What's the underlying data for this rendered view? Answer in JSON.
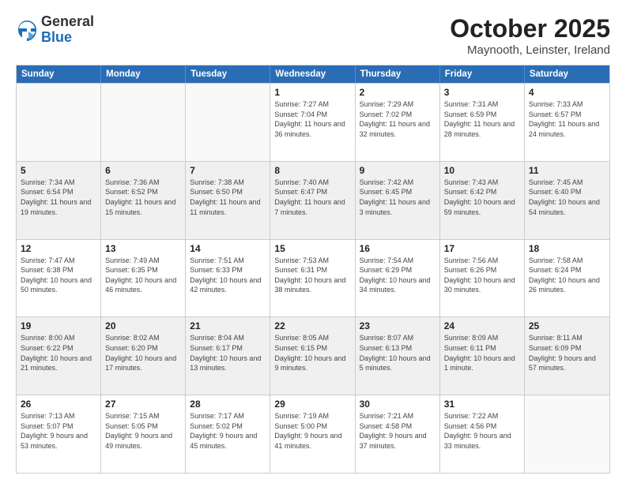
{
  "logo": {
    "general": "General",
    "blue": "Blue"
  },
  "title": "October 2025",
  "subtitle": "Maynooth, Leinster, Ireland",
  "days_of_week": [
    "Sunday",
    "Monday",
    "Tuesday",
    "Wednesday",
    "Thursday",
    "Friday",
    "Saturday"
  ],
  "weeks": [
    [
      {
        "day": "",
        "info": ""
      },
      {
        "day": "",
        "info": ""
      },
      {
        "day": "",
        "info": ""
      },
      {
        "day": "1",
        "info": "Sunrise: 7:27 AM\nSunset: 7:04 PM\nDaylight: 11 hours\nand 36 minutes."
      },
      {
        "day": "2",
        "info": "Sunrise: 7:29 AM\nSunset: 7:02 PM\nDaylight: 11 hours\nand 32 minutes."
      },
      {
        "day": "3",
        "info": "Sunrise: 7:31 AM\nSunset: 6:59 PM\nDaylight: 11 hours\nand 28 minutes."
      },
      {
        "day": "4",
        "info": "Sunrise: 7:33 AM\nSunset: 6:57 PM\nDaylight: 11 hours\nand 24 minutes."
      }
    ],
    [
      {
        "day": "5",
        "info": "Sunrise: 7:34 AM\nSunset: 6:54 PM\nDaylight: 11 hours\nand 19 minutes."
      },
      {
        "day": "6",
        "info": "Sunrise: 7:36 AM\nSunset: 6:52 PM\nDaylight: 11 hours\nand 15 minutes."
      },
      {
        "day": "7",
        "info": "Sunrise: 7:38 AM\nSunset: 6:50 PM\nDaylight: 11 hours\nand 11 minutes."
      },
      {
        "day": "8",
        "info": "Sunrise: 7:40 AM\nSunset: 6:47 PM\nDaylight: 11 hours\nand 7 minutes."
      },
      {
        "day": "9",
        "info": "Sunrise: 7:42 AM\nSunset: 6:45 PM\nDaylight: 11 hours\nand 3 minutes."
      },
      {
        "day": "10",
        "info": "Sunrise: 7:43 AM\nSunset: 6:42 PM\nDaylight: 10 hours\nand 59 minutes."
      },
      {
        "day": "11",
        "info": "Sunrise: 7:45 AM\nSunset: 6:40 PM\nDaylight: 10 hours\nand 54 minutes."
      }
    ],
    [
      {
        "day": "12",
        "info": "Sunrise: 7:47 AM\nSunset: 6:38 PM\nDaylight: 10 hours\nand 50 minutes."
      },
      {
        "day": "13",
        "info": "Sunrise: 7:49 AM\nSunset: 6:35 PM\nDaylight: 10 hours\nand 46 minutes."
      },
      {
        "day": "14",
        "info": "Sunrise: 7:51 AM\nSunset: 6:33 PM\nDaylight: 10 hours\nand 42 minutes."
      },
      {
        "day": "15",
        "info": "Sunrise: 7:53 AM\nSunset: 6:31 PM\nDaylight: 10 hours\nand 38 minutes."
      },
      {
        "day": "16",
        "info": "Sunrise: 7:54 AM\nSunset: 6:29 PM\nDaylight: 10 hours\nand 34 minutes."
      },
      {
        "day": "17",
        "info": "Sunrise: 7:56 AM\nSunset: 6:26 PM\nDaylight: 10 hours\nand 30 minutes."
      },
      {
        "day": "18",
        "info": "Sunrise: 7:58 AM\nSunset: 6:24 PM\nDaylight: 10 hours\nand 26 minutes."
      }
    ],
    [
      {
        "day": "19",
        "info": "Sunrise: 8:00 AM\nSunset: 6:22 PM\nDaylight: 10 hours\nand 21 minutes."
      },
      {
        "day": "20",
        "info": "Sunrise: 8:02 AM\nSunset: 6:20 PM\nDaylight: 10 hours\nand 17 minutes."
      },
      {
        "day": "21",
        "info": "Sunrise: 8:04 AM\nSunset: 6:17 PM\nDaylight: 10 hours\nand 13 minutes."
      },
      {
        "day": "22",
        "info": "Sunrise: 8:05 AM\nSunset: 6:15 PM\nDaylight: 10 hours\nand 9 minutes."
      },
      {
        "day": "23",
        "info": "Sunrise: 8:07 AM\nSunset: 6:13 PM\nDaylight: 10 hours\nand 5 minutes."
      },
      {
        "day": "24",
        "info": "Sunrise: 8:09 AM\nSunset: 6:11 PM\nDaylight: 10 hours\nand 1 minute."
      },
      {
        "day": "25",
        "info": "Sunrise: 8:11 AM\nSunset: 6:09 PM\nDaylight: 9 hours\nand 57 minutes."
      }
    ],
    [
      {
        "day": "26",
        "info": "Sunrise: 7:13 AM\nSunset: 5:07 PM\nDaylight: 9 hours\nand 53 minutes."
      },
      {
        "day": "27",
        "info": "Sunrise: 7:15 AM\nSunset: 5:05 PM\nDaylight: 9 hours\nand 49 minutes."
      },
      {
        "day": "28",
        "info": "Sunrise: 7:17 AM\nSunset: 5:02 PM\nDaylight: 9 hours\nand 45 minutes."
      },
      {
        "day": "29",
        "info": "Sunrise: 7:19 AM\nSunset: 5:00 PM\nDaylight: 9 hours\nand 41 minutes."
      },
      {
        "day": "30",
        "info": "Sunrise: 7:21 AM\nSunset: 4:58 PM\nDaylight: 9 hours\nand 37 minutes."
      },
      {
        "day": "31",
        "info": "Sunrise: 7:22 AM\nSunset: 4:56 PM\nDaylight: 9 hours\nand 33 minutes."
      },
      {
        "day": "",
        "info": ""
      }
    ]
  ]
}
